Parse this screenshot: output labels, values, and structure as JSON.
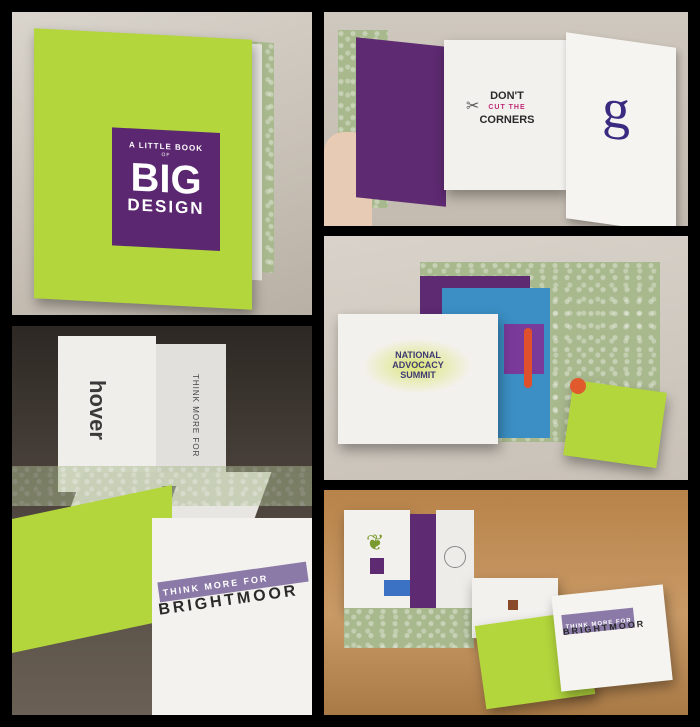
{
  "collage": {
    "cover": {
      "line1": "A LITTLE BOOK",
      "of": "OF",
      "big": "BIG",
      "design": "DESIGN"
    },
    "spread": {
      "dont": "DON'T",
      "cut_the": "CUT THE",
      "corners": "CORNERS",
      "g_letter": "g"
    },
    "summit": {
      "national": "NATIONAL",
      "advocacy": "ADVOCACY",
      "summit": "SUMMIT"
    },
    "hover": {
      "word": "hover",
      "think_more_for": "THINK MORE FOR",
      "brightmoor": "BRIGHTMOOR"
    },
    "foldout": {
      "think_more_for": "THINK MORE FOR",
      "brightmoor": "BRIGHTMOOR"
    }
  },
  "colors": {
    "lime": "#b2d63c",
    "purple": "#5e2a72",
    "blue": "#3b8fc4",
    "frame": "#000000"
  }
}
